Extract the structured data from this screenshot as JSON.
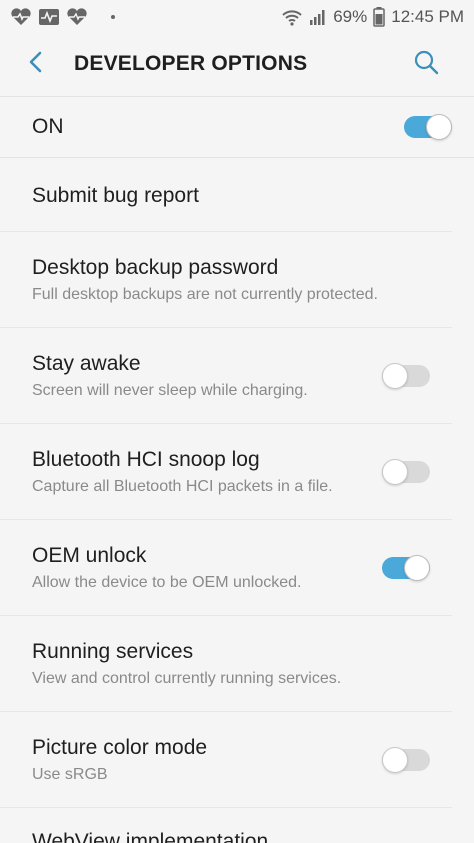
{
  "status_bar": {
    "battery": "69%",
    "time": "12:45 PM",
    "icons": [
      "heart-pulse-icon",
      "activity-icon",
      "heart-icon",
      "dot-icon",
      "wifi-icon",
      "signal-icon",
      "battery-icon"
    ]
  },
  "header": {
    "title": "DEVELOPER OPTIONS",
    "back_icon": "chevron-left-icon",
    "search_icon": "search-icon"
  },
  "master": {
    "label": "ON",
    "on": true
  },
  "settings": [
    {
      "title": "Submit bug report",
      "summary": "",
      "toggle": null
    },
    {
      "title": "Desktop backup password",
      "summary": "Full desktop backups are not currently protected.",
      "toggle": null
    },
    {
      "title": "Stay awake",
      "summary": "Screen will never sleep while charging.",
      "toggle": false
    },
    {
      "title": "Bluetooth HCI snoop log",
      "summary": "Capture all Bluetooth HCI packets in a file.",
      "toggle": false
    },
    {
      "title": "OEM unlock",
      "summary": "Allow the device to be OEM unlocked.",
      "toggle": true
    },
    {
      "title": "Running services",
      "summary": "View and control currently running services.",
      "toggle": null
    },
    {
      "title": "Picture color mode",
      "summary": "Use sRGB",
      "toggle": false
    },
    {
      "title": "WebView implementation",
      "summary": "",
      "toggle": null
    }
  ],
  "colors": {
    "accent": "#4aa9d9",
    "toggle_off": "#d9d9d9",
    "background": "#f5f5f5"
  }
}
